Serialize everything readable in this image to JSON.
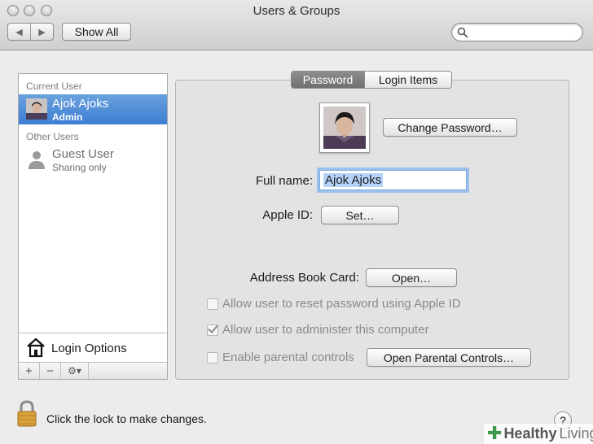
{
  "window": {
    "title": "Users & Groups"
  },
  "toolbar": {
    "back_icon": "◀",
    "forward_icon": "▶",
    "show_all_label": "Show All",
    "search_placeholder": ""
  },
  "sidebar": {
    "current_user_heading": "Current User",
    "current_user": {
      "name": "Ajok Ajoks",
      "role": "Admin"
    },
    "other_users_heading": "Other Users",
    "guest_user": {
      "name": "Guest User",
      "status": "Sharing only"
    },
    "login_options_label": "Login Options",
    "add_label": "+",
    "remove_label": "−",
    "gear_label": "⚙▾"
  },
  "tabs": [
    {
      "label": "Password",
      "active": true
    },
    {
      "label": "Login Items",
      "active": false
    }
  ],
  "account": {
    "change_password_label": "Change Password…",
    "full_name_label": "Full name:",
    "full_name_value": "Ajok Ajoks",
    "apple_id_label": "Apple ID:",
    "set_label": "Set…",
    "address_book_label": "Address Book Card:",
    "open_label": "Open…",
    "allow_reset_label": "Allow user to reset password using Apple ID",
    "allow_reset_checked": false,
    "allow_admin_label": "Allow user to administer this computer",
    "allow_admin_checked": true,
    "parental_label": "Enable parental controls",
    "parental_checked": false,
    "open_parental_label": "Open Parental Controls…"
  },
  "footer": {
    "lock_text": "Click the lock to make changes.",
    "help_label": "?"
  },
  "watermark": {
    "brand_bold": "Healthy",
    "brand_light": "Living"
  },
  "colors": {
    "selection": "#3d7ed3",
    "focus_ring": "#9cc1ee",
    "watermark_green": "#3c9a4a"
  }
}
